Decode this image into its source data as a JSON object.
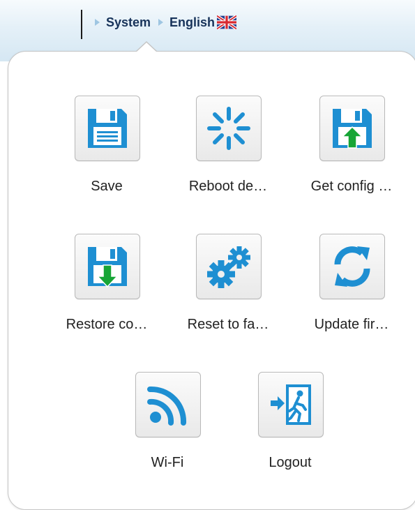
{
  "breadcrumb": {
    "system": "System",
    "language": "English"
  },
  "icons": {
    "flag": "uk-flag-icon",
    "save": "floppy-disk-icon",
    "reboot": "reboot-spinner-icon",
    "get_config": "floppy-upload-icon",
    "restore_config": "floppy-download-icon",
    "reset": "gears-icon",
    "update_firmware": "refresh-arrows-icon",
    "wifi": "wifi-signal-icon",
    "logout": "exit-door-icon"
  },
  "colors": {
    "icon_blue": "#1e8fd2",
    "icon_green": "#17a536",
    "nav_text": "#17335a",
    "topbar": "#d5e7f3"
  },
  "menu": {
    "items": [
      {
        "label": "Save"
      },
      {
        "label": "Reboot de…"
      },
      {
        "label": "Get config …"
      },
      {
        "label": "Restore co…"
      },
      {
        "label": "Reset to fa…"
      },
      {
        "label": "Update fir…"
      },
      {
        "label": "Wi-Fi"
      },
      {
        "label": "Logout"
      }
    ]
  }
}
